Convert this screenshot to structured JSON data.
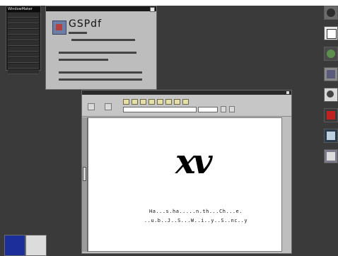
{
  "clip_panel": {
    "title": "WindowMaker",
    "items": [
      "",
      "",
      "",
      "",
      "",
      "",
      "",
      "",
      "",
      "",
      "",
      ""
    ]
  },
  "about": {
    "app_name": "GSPdf"
  },
  "xv": {
    "logo": "xv",
    "caption_line1": "Ha...s.ha.....n.th...Ch...e.",
    "caption_line2": "..u.b..J..S...W..i..y..S..nc..y"
  },
  "dock": {
    "icons": [
      "terminal-icon",
      "paper-icon",
      "globe-icon",
      "key-icon",
      "gears-icon",
      "red-book-icon",
      "netscape-icon",
      "wrench-icon"
    ]
  },
  "bottom_left": {
    "icons": [
      "blue-workspace-icon",
      "clock-icon"
    ]
  }
}
